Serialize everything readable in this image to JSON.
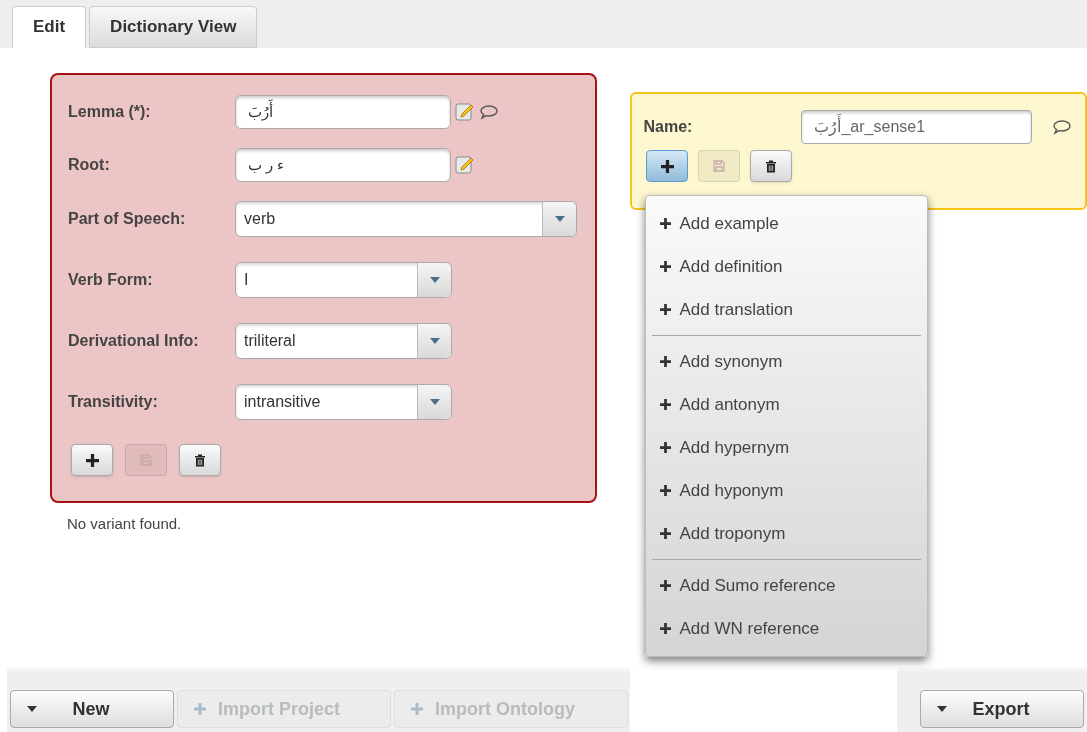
{
  "tabs": [
    {
      "label": "Edit",
      "selected": true
    },
    {
      "label": "Dictionary View",
      "selected": false
    }
  ],
  "entry_form": {
    "fields": [
      {
        "kind": "text",
        "label": "Lemma (*):",
        "value": "أَرُبَ",
        "edit_icon": true,
        "comment_icon": true
      },
      {
        "kind": "text",
        "label": "Root:",
        "value": "ء ر ب",
        "edit_icon": true,
        "comment_icon": false
      },
      {
        "kind": "select",
        "label": "Part of Speech:",
        "value": "verb",
        "wide": true
      },
      {
        "kind": "select",
        "label": "Verb Form:",
        "value": "I",
        "wide": false
      },
      {
        "kind": "select",
        "label": "Derivational Info:",
        "value": "triliteral",
        "wide": false
      },
      {
        "kind": "select",
        "label": "Transitivity:",
        "value": "intransitive",
        "wide": false
      }
    ],
    "buttons": [
      {
        "kind": "add",
        "disabled": false,
        "selected": false
      },
      {
        "kind": "save",
        "disabled": true,
        "selected": false
      },
      {
        "kind": "delete",
        "disabled": false,
        "selected": false
      }
    ]
  },
  "variant_message": "No variant found.",
  "sense_form": {
    "label": "Name:",
    "value": "أَرُبَ_ar_sense1",
    "comment_icon": true,
    "buttons": [
      {
        "kind": "add",
        "disabled": false,
        "selected": true
      },
      {
        "kind": "save",
        "disabled": true,
        "selected": false
      },
      {
        "kind": "delete",
        "disabled": false,
        "selected": false
      }
    ]
  },
  "add_menu": {
    "groups": [
      [
        "Add example",
        "Add definition",
        "Add translation"
      ],
      [
        "Add synonym",
        "Add antonym",
        "Add hypernym",
        "Add hyponym",
        "Add troponym"
      ],
      [
        "Add Sumo reference",
        "Add WN reference"
      ]
    ]
  },
  "toolbar_left": [
    {
      "kind": "dropdown",
      "label": "New",
      "disabled": false
    },
    {
      "kind": "plus",
      "label": "Import Project",
      "disabled": true
    },
    {
      "kind": "plus",
      "label": "Import Ontology",
      "disabled": true
    }
  ],
  "toolbar_right": [
    {
      "kind": "dropdown",
      "label": "Export",
      "disabled": false
    }
  ]
}
